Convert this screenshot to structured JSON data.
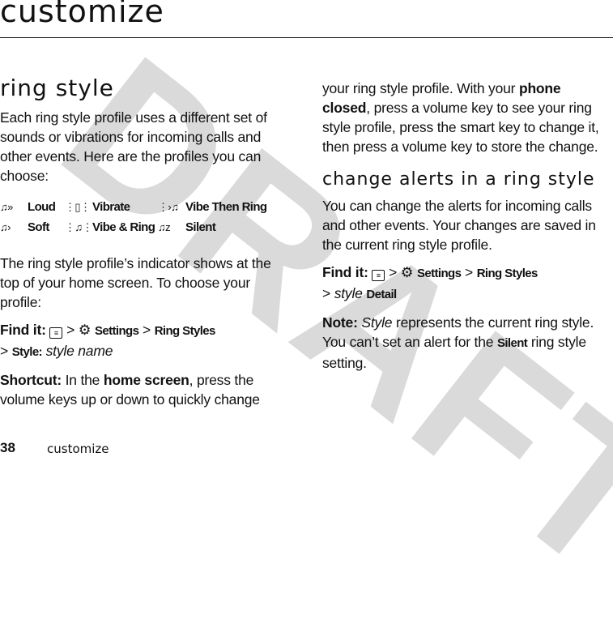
{
  "watermark": "DRAFT",
  "page_title": "customize",
  "left": {
    "heading": "ring style",
    "intro": "Each ring style profile uses a different set of sounds or vibrations for incoming calls and other events. Here are the profiles you can choose:",
    "profiles": [
      {
        "icon": "loud-ring-icon",
        "glyph": "♫»",
        "label": "Loud"
      },
      {
        "icon": "vibrate-icon",
        "glyph": "⋮▯⋮",
        "label": "Vibrate"
      },
      {
        "icon": "vibe-then-ring-icon",
        "glyph": "⋮›♫",
        "label": "Vibe Then Ring"
      },
      {
        "icon": "soft-ring-icon",
        "glyph": "♫›",
        "label": "Soft"
      },
      {
        "icon": "vibe-and-ring-icon",
        "glyph": "⋮♫⋮",
        "label": "Vibe & Ring"
      },
      {
        "icon": "silent-icon",
        "glyph": "♫z",
        "label": "Silent"
      }
    ],
    "indicator_text": "The ring style profile’s indicator shows at the top of your home screen. To choose your profile:",
    "findit": {
      "label": "Find it:",
      "menu_glyph": "≡",
      "sep": ">",
      "settings_glyph": "⚙",
      "settings": "Settings",
      "ring_styles": "Ring Styles",
      "style_label": "Style:",
      "style_value": "style name"
    },
    "shortcut": {
      "label": "Shortcut:",
      "text1": " In the ",
      "bold1": "home screen",
      "text2": ", press the volume keys up or down to quickly change"
    }
  },
  "right": {
    "continued": {
      "text1": "your ring style profile. With your ",
      "bold1": "phone closed",
      "text2": ", press a volume key to see your ring style profile, press the smart key to change it, then press a volume key to store the change."
    },
    "heading": "change alerts in a ring style",
    "intro": "You can change the alerts for incoming calls and other events. Your changes are saved in the current ring style profile.",
    "findit": {
      "label": "Find it:",
      "menu_glyph": "≡",
      "sep": ">",
      "settings_glyph": "⚙",
      "settings": "Settings",
      "ring_styles": "Ring Styles",
      "style_italic": "style",
      "detail": "Detail"
    },
    "note": {
      "label": "Note:",
      "italic": "Style",
      "text1": " represents the current ring style. You can’t set an alert for the ",
      "bold": "Silent",
      "text2": " ring style setting."
    }
  },
  "footer": {
    "page_number": "38",
    "section": "customize"
  }
}
